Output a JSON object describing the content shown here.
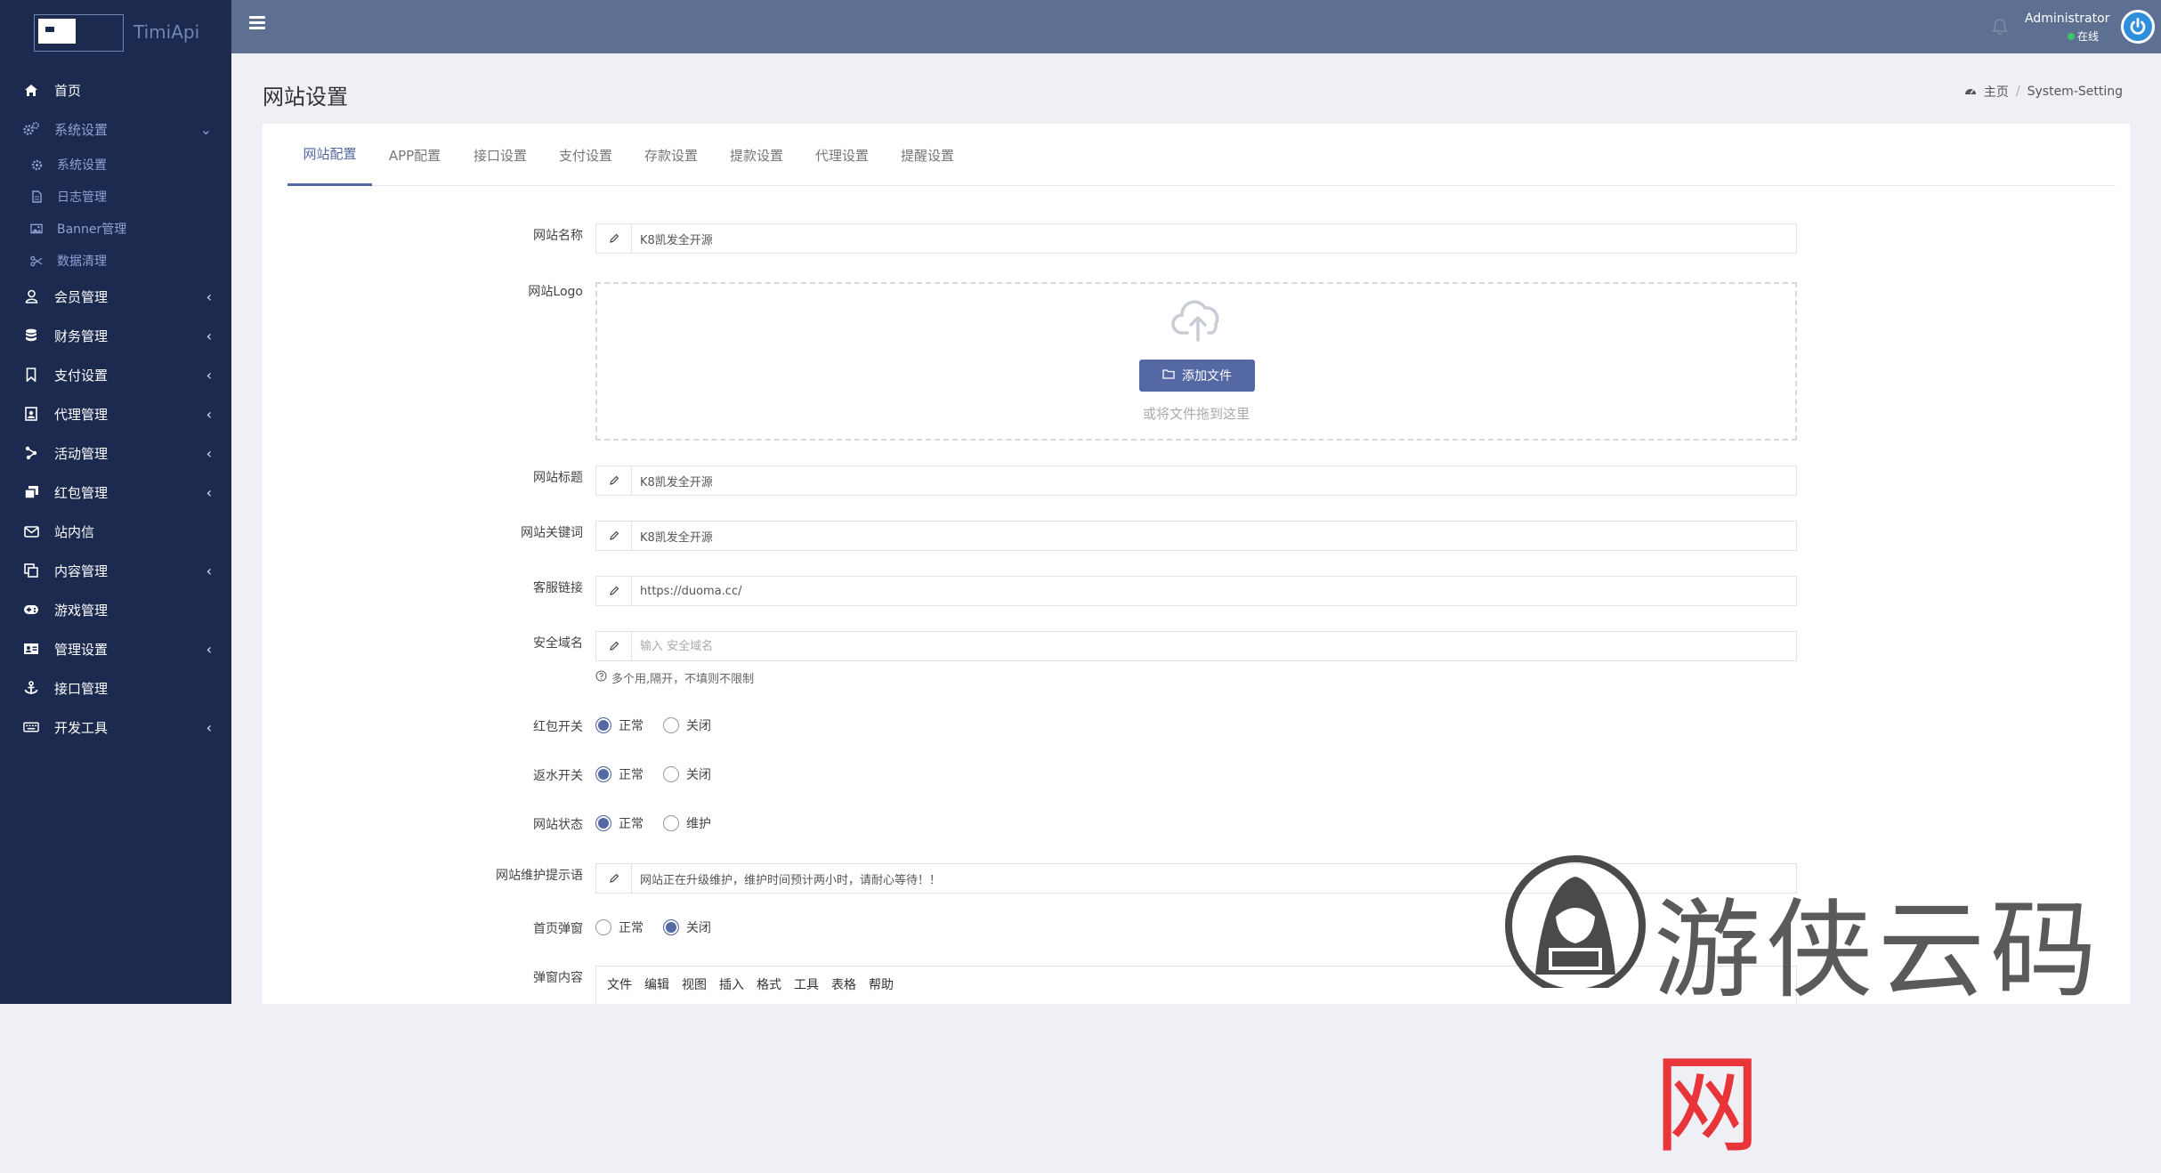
{
  "app": {
    "logo_text": "TimiApi"
  },
  "sidebar": {
    "items": [
      {
        "label": "首页",
        "icon": "home-icon",
        "caret": ""
      },
      {
        "label": "系统设置",
        "icon": "cogs-icon",
        "caret": "⌄",
        "active": true,
        "children": [
          {
            "label": "系统设置",
            "icon": "gear-icon"
          },
          {
            "label": "日志管理",
            "icon": "file-icon"
          },
          {
            "label": "Banner管理",
            "icon": "image-icon"
          },
          {
            "label": "数据清理",
            "icon": "scissors-icon"
          }
        ]
      },
      {
        "label": "会员管理",
        "icon": "user-icon",
        "caret": "‹"
      },
      {
        "label": "财务管理",
        "icon": "database-icon",
        "caret": "‹"
      },
      {
        "label": "支付设置",
        "icon": "bookmark-icon",
        "caret": "‹"
      },
      {
        "label": "代理管理",
        "icon": "badge-icon",
        "caret": "‹"
      },
      {
        "label": "活动管理",
        "icon": "activity-icon",
        "caret": "‹"
      },
      {
        "label": "红包管理",
        "icon": "gift-icon",
        "caret": "‹"
      },
      {
        "label": "站内信",
        "icon": "envelope-icon",
        "caret": ""
      },
      {
        "label": "内容管理",
        "icon": "copy-icon",
        "caret": "‹"
      },
      {
        "label": "游戏管理",
        "icon": "gamepad-icon",
        "caret": ""
      },
      {
        "label": "管理设置",
        "icon": "id-card-icon",
        "caret": "‹"
      },
      {
        "label": "接口管理",
        "icon": "anchor-icon",
        "caret": ""
      },
      {
        "label": "开发工具",
        "icon": "keyboard-icon",
        "caret": "‹"
      }
    ]
  },
  "topbar": {
    "user_name": "Administrator",
    "user_status": "在线"
  },
  "header": {
    "title": "网站设置"
  },
  "breadcrumb": {
    "home": "主页",
    "current": "System-Setting"
  },
  "tabs": [
    "网站配置",
    "APP配置",
    "接口设置",
    "支付设置",
    "存款设置",
    "提款设置",
    "代理设置",
    "提醒设置"
  ],
  "form": {
    "site_name": {
      "label": "网站名称",
      "value": "K8凯发全开源"
    },
    "site_logo": {
      "label": "网站Logo",
      "button": "添加文件",
      "hint": "或将文件拖到这里"
    },
    "site_title": {
      "label": "网站标题",
      "value": "K8凯发全开源"
    },
    "site_keywords": {
      "label": "网站关键词",
      "value": "K8凯发全开源"
    },
    "service_link": {
      "label": "客服链接",
      "value": "https://duoma.cc/"
    },
    "safe_domain": {
      "label": "安全域名",
      "value": "",
      "placeholder": "输入 安全域名",
      "help": "多个用,隔开，不填则不限制"
    },
    "redpack_switch": {
      "label": "红包开关",
      "opt1": "正常",
      "opt2": "关闭",
      "selected": "正常"
    },
    "rebate_switch": {
      "label": "返水开关",
      "opt1": "正常",
      "opt2": "关闭",
      "selected": "正常"
    },
    "site_status": {
      "label": "网站状态",
      "opt1": "正常",
      "opt2": "维护",
      "selected": "正常"
    },
    "maintenance_tip": {
      "label": "网站维护提示语",
      "value": "网站正在升级维护，维护时间预计两小时，请耐心等待！！"
    },
    "home_popup": {
      "label": "首页弹窗",
      "opt1": "正常",
      "opt2": "关闭",
      "selected": "关闭"
    },
    "popup_content": {
      "label": "弹窗内容",
      "menu": [
        "文件",
        "编辑",
        "视图",
        "插入",
        "格式",
        "工具",
        "表格",
        "帮助"
      ]
    }
  },
  "watermark": {
    "text_main": "游侠云码",
    "text_accent": "网"
  },
  "colors": {
    "sidebar_bg": "#1b2a4e",
    "topbar_bg": "#5d7091",
    "accent": "#5468a3",
    "online": "#3cc46a"
  }
}
